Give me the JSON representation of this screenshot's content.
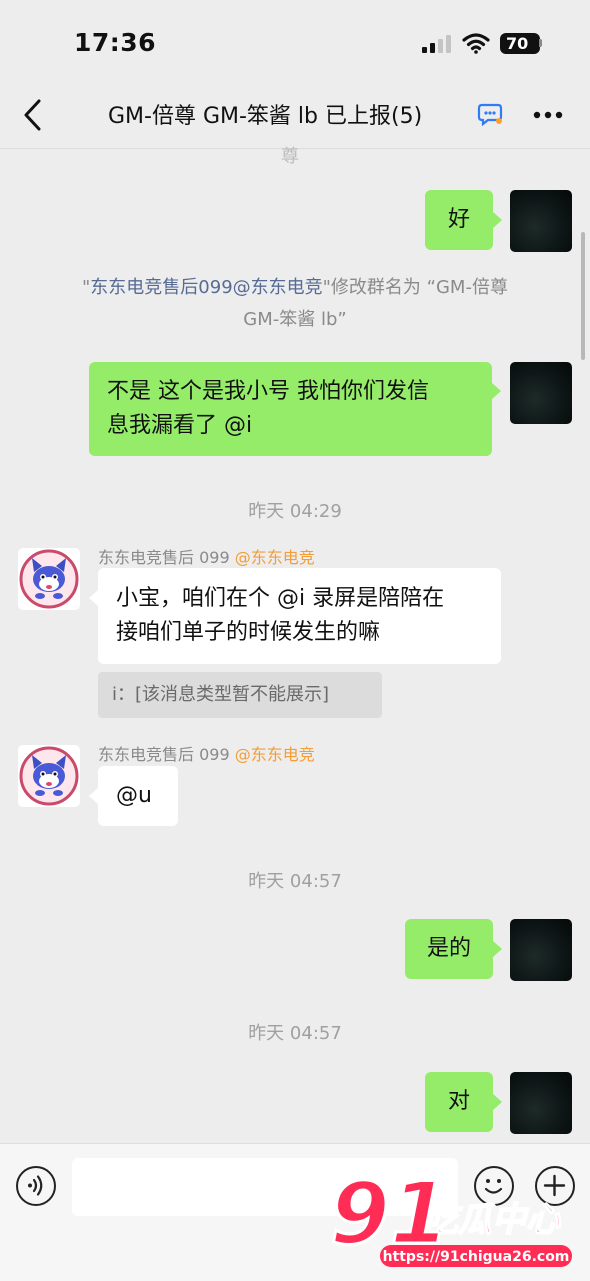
{
  "status_bar": {
    "time": "17:36",
    "battery": "70"
  },
  "header": {
    "back_icon": "chevron-left-icon",
    "title": "GM-倍尊 GM-笨酱 lb 已上报(5)",
    "more_icon": "more-icon"
  },
  "chat": {
    "top_cut_text": "尊",
    "msg1": {
      "text": "好"
    },
    "rename_notice": {
      "prefix": "\"",
      "user": "东东电竞售后099@东东电竞",
      "suffix": "\"修改群名为 “GM-倍尊",
      "line2": "GM-笨酱  lb”"
    },
    "msg2": {
      "line1": "不是 这个是我小号 我怕你们发信",
      "line2": "息我漏看了 @i"
    },
    "time1": "昨天 04:29",
    "msg3": {
      "sender": "东东电竞售后 099",
      "sender_tag": "@东东电竞",
      "line1": "小宝，咱们在个 @i 录屏是陪陪在",
      "line2": "接咱们单子的时候发生的嘛",
      "quote": "i：[该消息类型暂不能展示]"
    },
    "msg4": {
      "sender": "东东电竞售后 099",
      "sender_tag": "@东东电竞",
      "text": "@u"
    },
    "time2": "昨天 04:57",
    "msg5": {
      "text": "是的"
    },
    "time3": "昨天 04:57",
    "msg6": {
      "text": "对"
    }
  },
  "watermark": {
    "number": "91",
    "name": "吃瓜中心",
    "url": "https://91chigua26.com"
  },
  "colors": {
    "bubble_me": "#95ec69",
    "bubble_other": "#ffffff",
    "link": "#576b95",
    "tag": "#f29d38",
    "watermark": "#ff2d55"
  }
}
